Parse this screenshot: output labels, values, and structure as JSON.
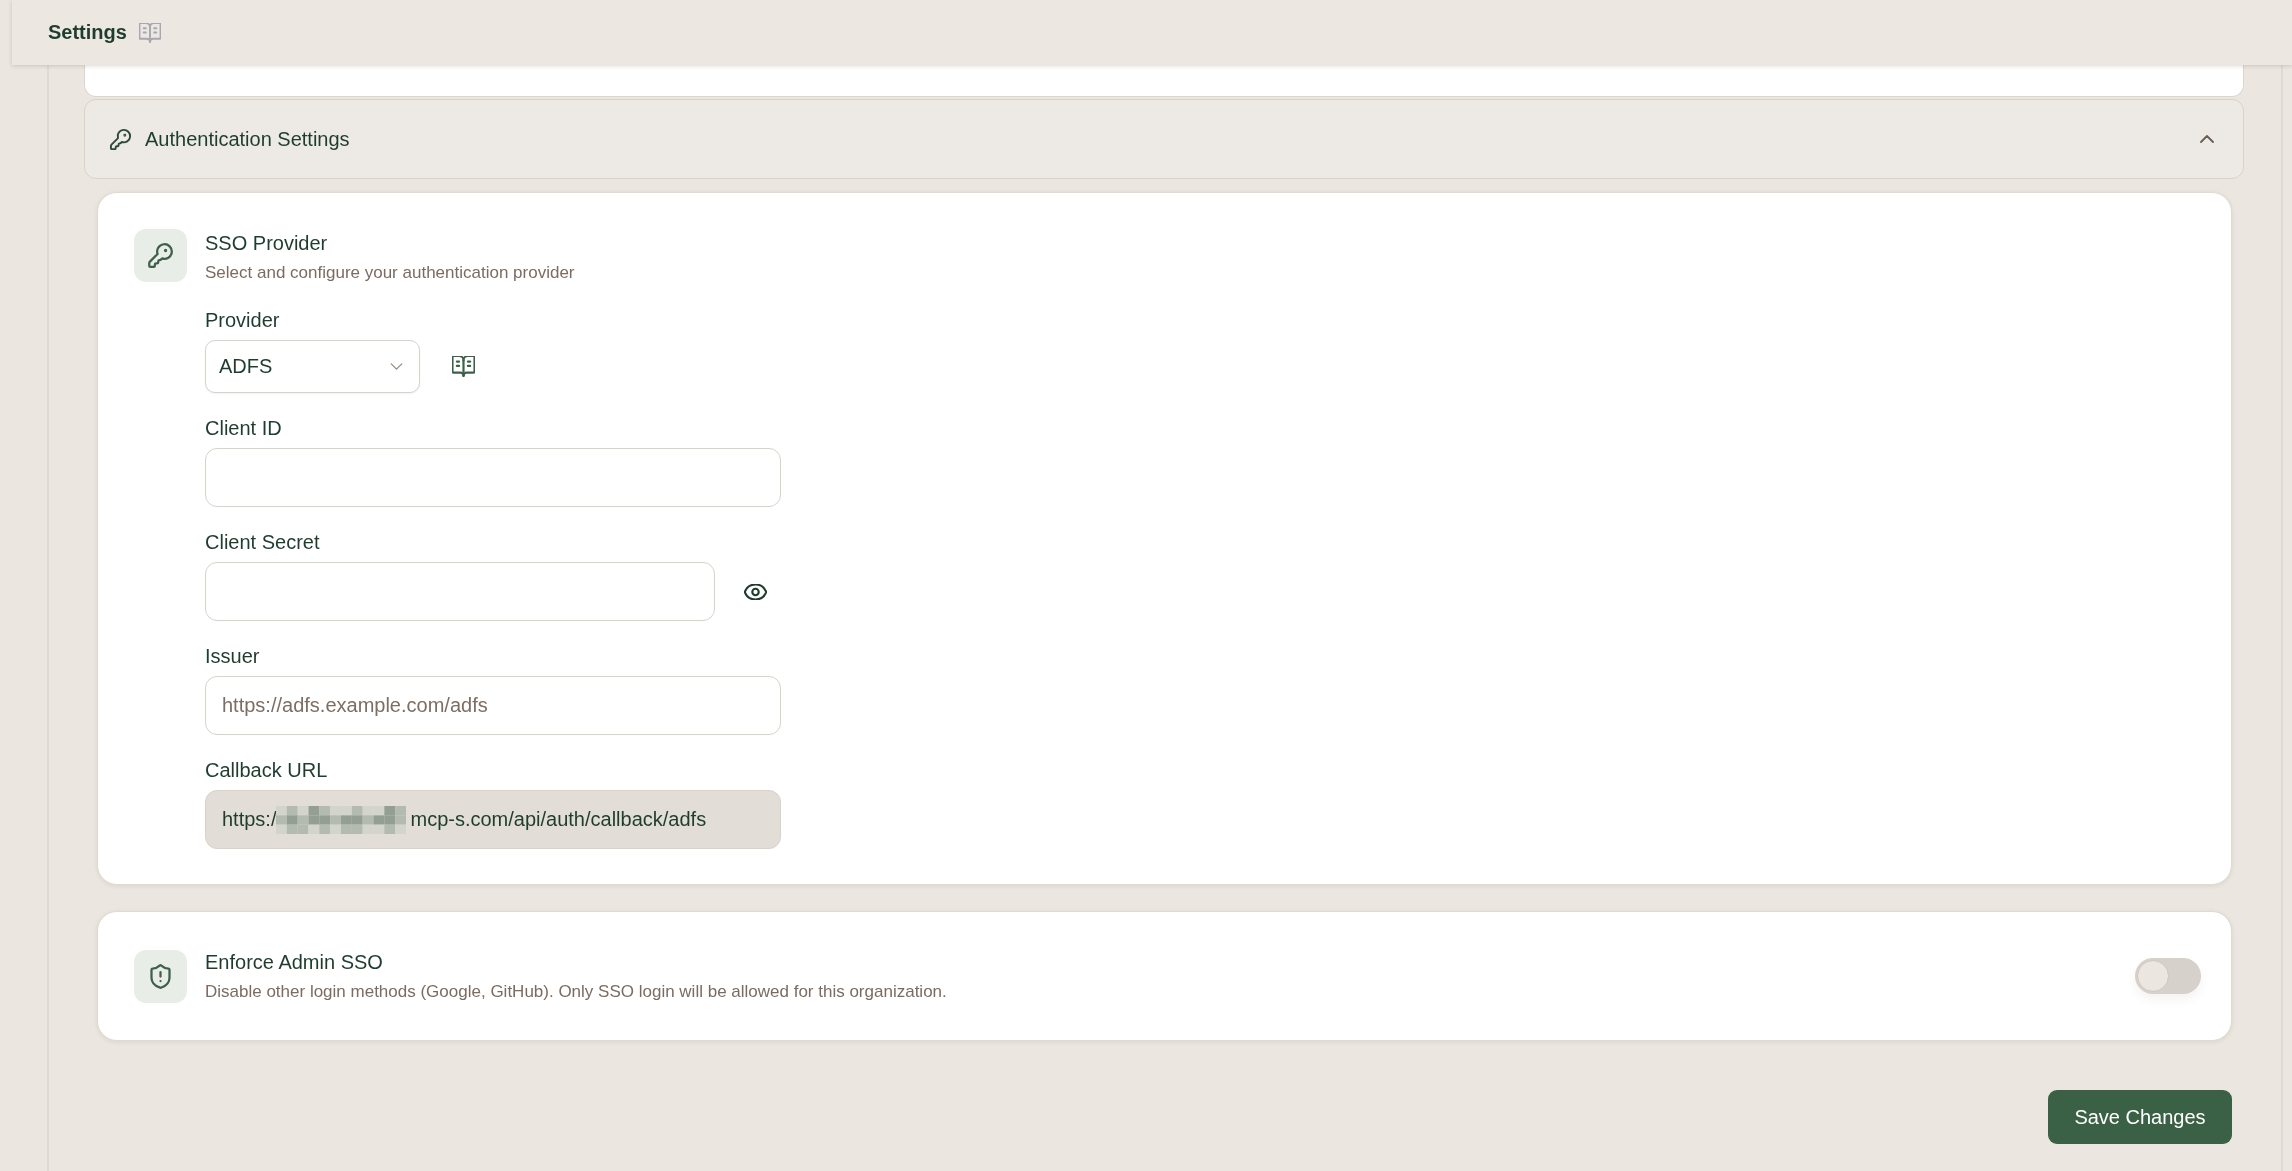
{
  "header": {
    "title": "Settings"
  },
  "section": {
    "title": "Authentication Settings",
    "expanded": true
  },
  "sso_card": {
    "title": "SSO Provider",
    "subtitle": "Select and configure your authentication provider",
    "fields": [
      {
        "kind": "select",
        "label": "Provider",
        "value": "ADFS"
      },
      {
        "kind": "text",
        "label": "Client ID"
      },
      {
        "kind": "secret",
        "label": "Client Secret"
      },
      {
        "kind": "text",
        "label": "Issuer",
        "placeholder": "https://adfs.example.com/adfs"
      },
      {
        "kind": "readonly",
        "label": "Callback URL",
        "value_before_redaction": "https:/",
        "value_after_redaction": "mcp-s.com/api/auth/callback/adfs"
      }
    ]
  },
  "enforce_card": {
    "title": "Enforce Admin SSO",
    "subtitle": "Disable other login methods (Google, GitHub). Only SSO login will be allowed for this organization.",
    "on": false
  },
  "buttons": [
    {
      "label": "Save Changes"
    }
  ]
}
